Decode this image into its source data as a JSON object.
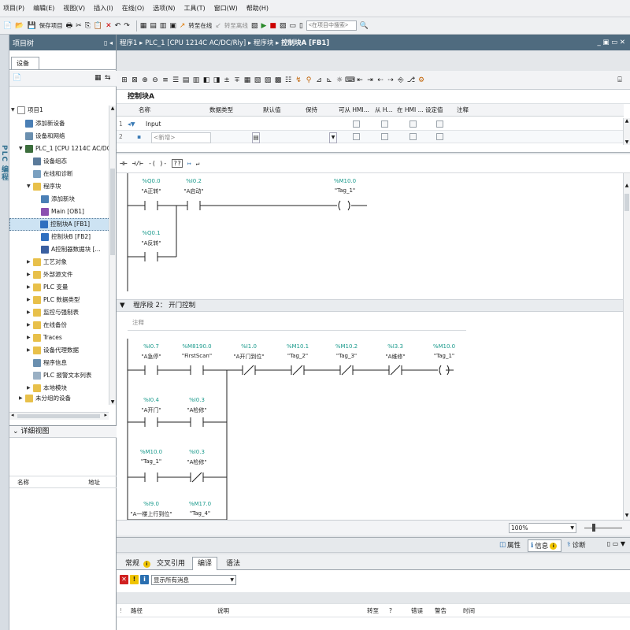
{
  "menu": [
    "项目(P)",
    "编辑(E)",
    "视图(V)",
    "插入(I)",
    "在线(O)",
    "选项(N)",
    "工具(T)",
    "窗口(W)",
    "帮助(H)"
  ],
  "toolbar": {
    "save_project": "保存项目",
    "go_online": "转至在线",
    "go_offline": "转至离线",
    "search_placeholder": "<在项目中搜索>"
  },
  "sidebar_vertical_label": "PLC 编程",
  "project_tree": {
    "title": "项目树",
    "tab": "设备",
    "items": [
      "项目1",
      "添加新设备",
      "设备和网络",
      "PLC_1 [CPU 1214C AC/DC...",
      "设备组态",
      "在线和诊断",
      "程序块",
      "添加新块",
      "Main [OB1]",
      "控制块A [FB1]",
      "控制块B [FB2]",
      "A控制器数据块 [...",
      "工艺对象",
      "外部源文件",
      "PLC 变量",
      "PLC 数据类型",
      "监控与强制表",
      "在线备份",
      "Traces",
      "设备代理数据",
      "程序信息",
      "PLC 报警文本列表",
      "本地模块",
      "未分组的设备"
    ]
  },
  "details": {
    "title": "详细视图",
    "col_name": "名称",
    "col_address": "地址"
  },
  "editor": {
    "breadcrumb": [
      "程序1",
      "PLC_1 [CPU 1214C AC/DC/Rly]",
      "程序块",
      "控制块A [FB1]"
    ],
    "block_title": "控制块A",
    "interface": {
      "headers": [
        "名称",
        "数据类型",
        "默认值",
        "保持",
        "可从 HMI...",
        "从 H...",
        "在 HMI ...",
        "设定值",
        "注释"
      ],
      "rows": [
        {
          "num": "1",
          "name": "Input"
        },
        {
          "num": "2",
          "name": "<新增>"
        }
      ]
    },
    "instructions": [
      "⊣⊢",
      "⊣/⊢",
      "-( )-",
      "??",
      "↦",
      "↵"
    ],
    "network1": {
      "contacts": [
        {
          "addr": "%Q0.0",
          "tag": "\"A正转\""
        },
        {
          "addr": "%I0.2",
          "tag": "\"A启动\""
        },
        {
          "addr": "%Q0.1",
          "tag": "\"A反转\""
        }
      ],
      "coil": {
        "addr": "%M10.0",
        "tag": "\"Tag_1\""
      }
    },
    "network2": {
      "label": "程序段 2：",
      "title": "开门控制",
      "comment": "注释",
      "row1": [
        {
          "addr": "%I0.7",
          "tag": "\"A急停\""
        },
        {
          "addr": "%M8190.0",
          "tag": "\"FirstScan\""
        },
        {
          "addr": "%I1.0",
          "tag": "\"A开门到位\""
        },
        {
          "addr": "%M10.1",
          "tag": "\"Tag_2\""
        },
        {
          "addr": "%M10.2",
          "tag": "\"Tag_3\""
        },
        {
          "addr": "%I3.3",
          "tag": "\"A维修\""
        }
      ],
      "coil": {
        "addr": "%M10.0",
        "tag": "\"Tag_1\""
      },
      "branch": [
        {
          "addr": "%I0.4",
          "tag": "\"A开门\""
        },
        {
          "addr": "%I0.3",
          "tag": "\"A检修\""
        },
        {
          "addr": "%M10.0",
          "tag": "\"Tag_1\""
        },
        {
          "addr": "%I0.3",
          "tag": "\"A检修\""
        },
        {
          "addr": "%I9.0",
          "tag": "\"A一楼上行到位\""
        },
        {
          "addr": "%M17.0",
          "tag": "\"Tag_4\""
        }
      ]
    },
    "zoom": "100%"
  },
  "inspector": {
    "properties": "属性",
    "info": "信息",
    "diagnostics": "诊断",
    "tabs": [
      "常规",
      "交叉引用",
      "编译",
      "语法"
    ],
    "active_tab": "编译",
    "filter": "显示所有消息",
    "columns": [
      "路径",
      "说明",
      "转至",
      "?",
      "错误",
      "警告",
      "时间"
    ]
  },
  "colors": {
    "title_bar": "#4f6b7f",
    "address_teal": "#1a9a8c",
    "selection": "#cde3f3"
  }
}
